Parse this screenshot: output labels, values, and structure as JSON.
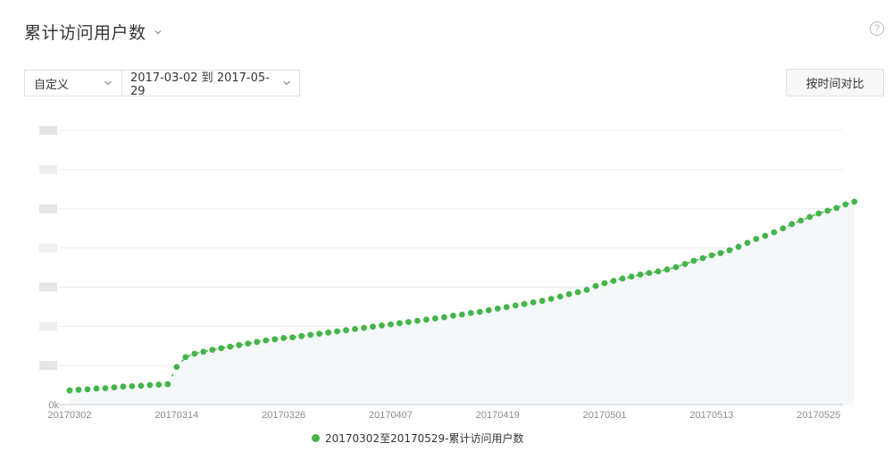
{
  "header": {
    "title": "累计访问用户数",
    "help_icon": "?"
  },
  "filters": {
    "mode": "自定义",
    "date_range": "2017-03-02 到 2017-05-29"
  },
  "compare_button": "按时间对比",
  "colors": {
    "series": "#44b549",
    "area": "#f4f8fa",
    "grid": "#ececec"
  },
  "chart_data": {
    "type": "line",
    "x_tick_labels": [
      "20170302",
      "20170314",
      "20170326",
      "20170407",
      "20170419",
      "20170501",
      "20170513",
      "20170525"
    ],
    "y_tick_labels": [
      "0k"
    ],
    "ylim": [
      0,
      7
    ],
    "grid": true,
    "legend_position": "bottom",
    "series": [
      {
        "name": "20170302至20170529-累计访问用户数",
        "x": [
          "20170302",
          "20170303",
          "20170304",
          "20170305",
          "20170306",
          "20170307",
          "20170308",
          "20170309",
          "20170310",
          "20170311",
          "20170312",
          "20170313",
          "20170314",
          "20170315",
          "20170316",
          "20170317",
          "20170318",
          "20170319",
          "20170320",
          "20170321",
          "20170322",
          "20170323",
          "20170324",
          "20170325",
          "20170326",
          "20170327",
          "20170328",
          "20170329",
          "20170330",
          "20170331",
          "20170401",
          "20170402",
          "20170403",
          "20170404",
          "20170405",
          "20170406",
          "20170407",
          "20170408",
          "20170409",
          "20170410",
          "20170411",
          "20170412",
          "20170413",
          "20170414",
          "20170415",
          "20170416",
          "20170417",
          "20170418",
          "20170419",
          "20170420",
          "20170421",
          "20170422",
          "20170423",
          "20170424",
          "20170425",
          "20170426",
          "20170427",
          "20170428",
          "20170429",
          "20170430",
          "20170501",
          "20170502",
          "20170503",
          "20170504",
          "20170505",
          "20170506",
          "20170507",
          "20170508",
          "20170509",
          "20170510",
          "20170511",
          "20170512",
          "20170513",
          "20170514",
          "20170515",
          "20170516",
          "20170517",
          "20170518",
          "20170519",
          "20170520",
          "20170521",
          "20170522",
          "20170523",
          "20170524",
          "20170525",
          "20170526",
          "20170527",
          "20170528",
          "20170529"
        ],
        "values": [
          0.36,
          0.38,
          0.39,
          0.41,
          0.42,
          0.44,
          0.46,
          0.47,
          0.48,
          0.5,
          0.51,
          0.52,
          0.96,
          1.21,
          1.3,
          1.35,
          1.4,
          1.44,
          1.48,
          1.52,
          1.56,
          1.6,
          1.64,
          1.67,
          1.7,
          1.72,
          1.75,
          1.78,
          1.81,
          1.84,
          1.87,
          1.9,
          1.93,
          1.96,
          1.99,
          2.02,
          2.05,
          2.08,
          2.11,
          2.14,
          2.17,
          2.2,
          2.23,
          2.27,
          2.3,
          2.34,
          2.37,
          2.41,
          2.45,
          2.49,
          2.53,
          2.57,
          2.61,
          2.65,
          2.7,
          2.76,
          2.82,
          2.87,
          2.93,
          3.03,
          3.1,
          3.16,
          3.22,
          3.27,
          3.32,
          3.36,
          3.4,
          3.45,
          3.51,
          3.59,
          3.67,
          3.74,
          3.81,
          3.87,
          3.94,
          4.03,
          4.13,
          4.23,
          4.31,
          4.4,
          4.5,
          4.61,
          4.7,
          4.79,
          4.88,
          4.95,
          5.02,
          5.11,
          5.18
        ]
      }
    ]
  }
}
